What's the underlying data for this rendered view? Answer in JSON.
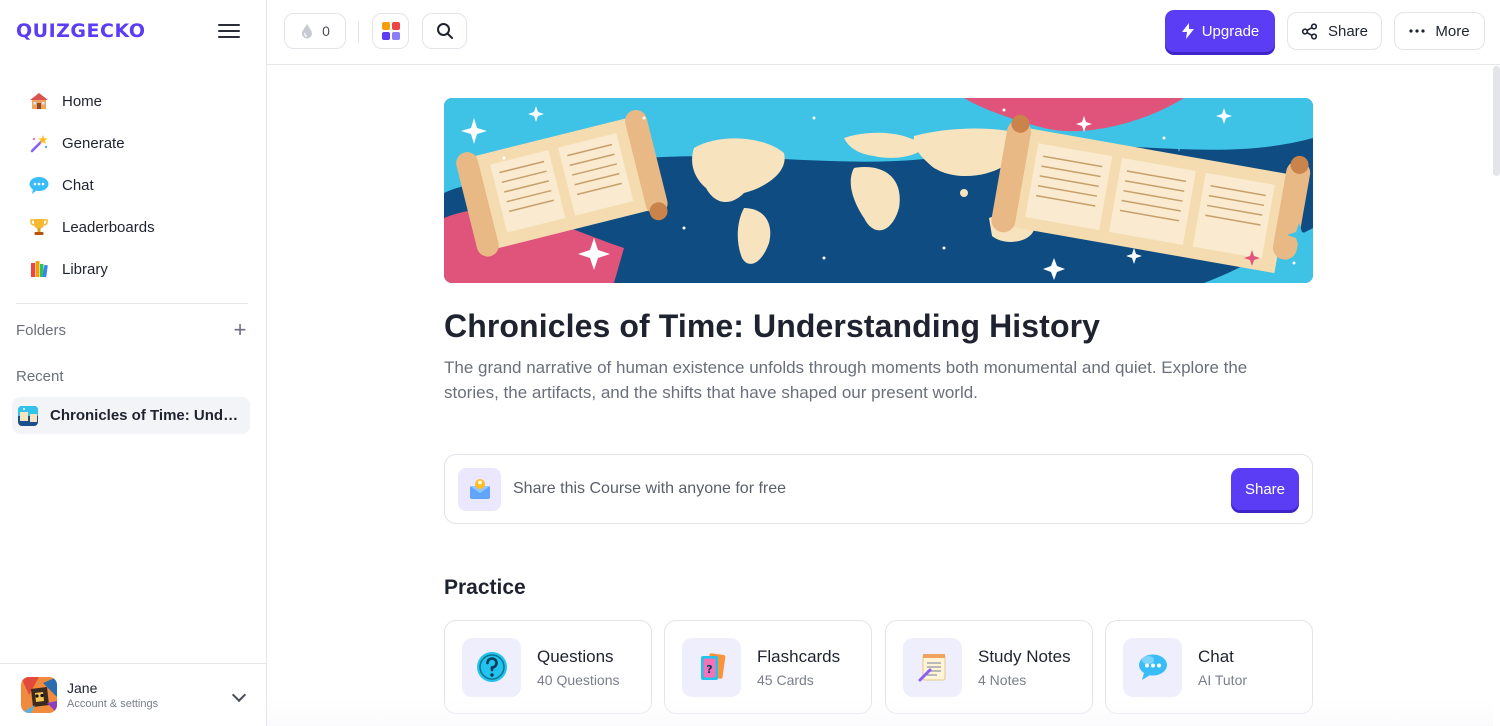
{
  "brand": {
    "name": "QUIZGECKO",
    "color": "#5b3df5"
  },
  "sidebar": {
    "items": [
      {
        "label": "Home",
        "icon": "school-house-icon"
      },
      {
        "label": "Generate",
        "icon": "magic-wand-icon"
      },
      {
        "label": "Chat",
        "icon": "chat-cloud-icon"
      },
      {
        "label": "Leaderboards",
        "icon": "trophy-icon"
      },
      {
        "label": "Library",
        "icon": "books-icon"
      }
    ],
    "folders_label": "Folders",
    "recent_label": "Recent",
    "recent_items": [
      {
        "title": "Chronicles of Time: Understanding History"
      }
    ],
    "account": {
      "name": "Jane",
      "subtitle": "Account & settings"
    }
  },
  "topbar": {
    "drops_count": "0",
    "upgrade_label": "Upgrade",
    "share_label": "Share",
    "more_label": "More"
  },
  "course": {
    "title": "Chronicles of Time: Understanding History",
    "description": "The grand narrative of human existence unfolds through moments both monumental and quiet. Explore the stories, the artifacts, and the shifts that have shaped our present world.",
    "share_prompt": "Share this Course with anyone for free",
    "share_button": "Share"
  },
  "practice": {
    "heading": "Practice",
    "cards": [
      {
        "title": "Questions",
        "subtitle": "40 Questions",
        "icon": "question-mark-icon"
      },
      {
        "title": "Flashcards",
        "subtitle": "45 Cards",
        "icon": "flashcards-icon"
      },
      {
        "title": "Study Notes",
        "subtitle": "4 Notes",
        "icon": "notepad-icon"
      },
      {
        "title": "Chat",
        "subtitle": "AI Tutor",
        "icon": "chat-bubble-icon"
      }
    ]
  },
  "colors": {
    "accent": "#5b3df5",
    "accent_shadow": "#3f25c9",
    "border": "#e3e4ea"
  }
}
